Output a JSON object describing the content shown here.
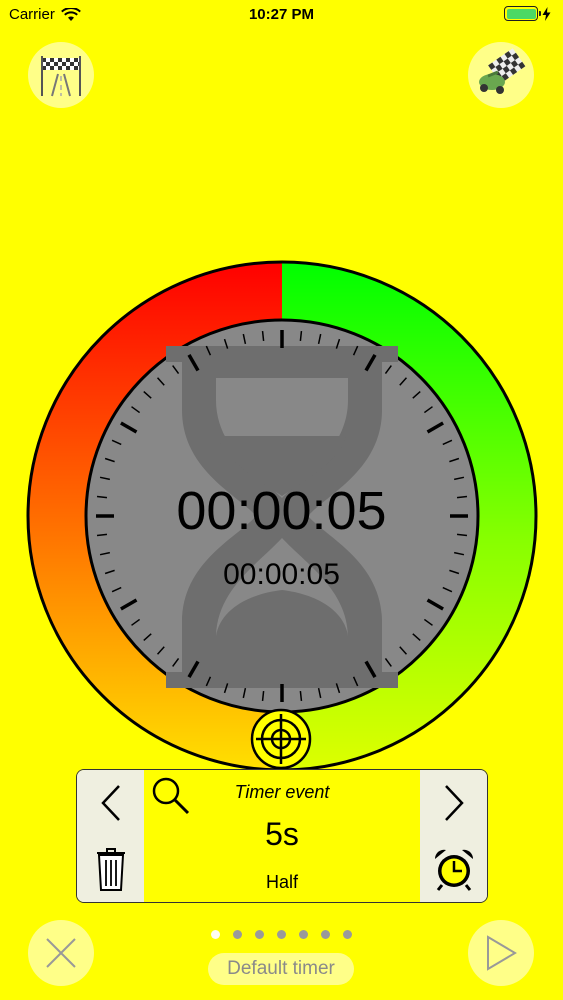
{
  "status_bar": {
    "carrier": "Carrier",
    "time": "10:27 PM",
    "wifi_icon": "wifi-icon",
    "battery_icon": "battery-icon",
    "charging_icon": "lightning-icon",
    "battery_level": 1.0
  },
  "top_bar": {
    "left_icon": "race-track-finish-flag-icon",
    "right_icon": "race-car-checkered-flag-icon"
  },
  "timer": {
    "main_time": "00:00:05",
    "sub_time": "00:00:05",
    "colors": {
      "left_ring_top": "#ff0000",
      "left_ring_bottom": "#ffe000",
      "right_ring_top": "#00ff00",
      "right_ring_bottom": "#ddff00",
      "face": "#888888",
      "background": "#ffff00"
    }
  },
  "event_panel": {
    "title": "Timer event",
    "value": "5s",
    "mode": "Half",
    "prev_icon": "chevron-left-icon",
    "next_icon": "chevron-right-icon",
    "search_icon": "search-icon",
    "delete_icon": "trash-icon",
    "alarm_icon": "alarm-clock-icon"
  },
  "pager": {
    "count": 7,
    "active_index": 0
  },
  "footer": {
    "label": "Default timer",
    "cancel_icon": "close-icon",
    "play_icon": "play-icon"
  }
}
